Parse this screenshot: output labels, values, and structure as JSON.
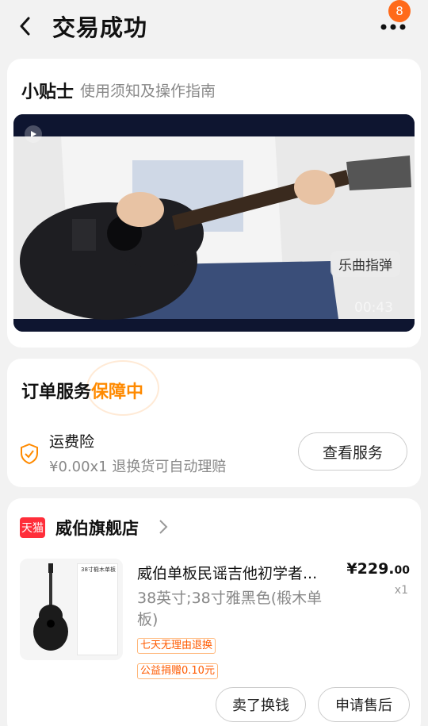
{
  "header": {
    "title": "交易成功",
    "badge_count": "8"
  },
  "tips": {
    "title": "小贴士",
    "subtitle": "使用须知及操作指南",
    "video": {
      "tag": "乐曲指弹",
      "duration": "00:43"
    }
  },
  "service": {
    "title_prefix": "订单服务",
    "title_highlight": "保障中",
    "item_name": "运费险",
    "item_desc": "¥0.00x1  退换货可自动理赔",
    "view_button": "查看服务"
  },
  "order": {
    "store_badge": "天猫",
    "shop_name": "威伯旗舰店",
    "product": {
      "image_label": "38寸椴木单板",
      "title": "威伯单板民谣吉他初学者...",
      "spec": "38英寸;38寸雅黑色(椴木单板)",
      "price_main": "¥229.",
      "price_decimal": "00",
      "quantity": "x1",
      "tag_return": "七天无理由退换",
      "tag_charity": "公益捐赠0.10元"
    },
    "buttons": {
      "sell": "卖了换钱",
      "after_sale": "申请售后"
    }
  },
  "colors": {
    "accent": "#ff8a00",
    "badge": "#ff6a1a",
    "tmall_red": "#ff2e3a"
  }
}
